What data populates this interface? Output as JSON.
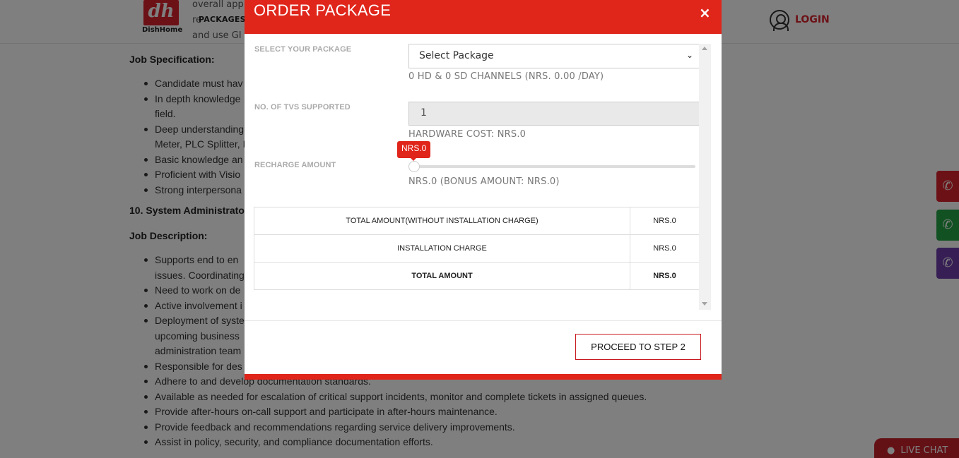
{
  "header": {
    "logo_text": "DishHome",
    "logo_mark": "dh",
    "nav_packages": "PACKAGES",
    "login_label": "LOGIN",
    "partial_lines": [
      "overall app",
      "re",
      "and use GI"
    ]
  },
  "background": {
    "job_spec_heading": "Job Specification:",
    "job_spec_items": [
      [
        "Candidate must hav"
      ],
      [
        "In depth knowledge",
        "field."
      ],
      [
        "Deep understanding",
        "Meter, PLC Splitter, I"
      ],
      [
        "Basic knowledge an"
      ],
      [
        "Proficient with Visio"
      ],
      [
        "Strong interpersona"
      ]
    ],
    "sysadmin_heading": "10. System Administrato",
    "job_desc_heading": "Job Description:",
    "job_desc_items": [
      [
        "Supports end to en",
        "issues. Coordinating"
      ],
      [
        "Need to work on de"
      ],
      [
        "Active involvement i"
      ],
      [
        "Deployment of syste",
        "upcoming  business",
        "administration team"
      ],
      [
        "Responsible for des"
      ],
      [
        "Adhere to and develop documentation standards."
      ],
      [
        "Available as needed for escalation of critical support incidents, monitor and complete tickets in assigned queues."
      ],
      [
        "Provide after-hours on-call support and participate in after-hours maintenance."
      ],
      [
        "Provide feedback and recommendations regarding service delivery improvements."
      ],
      [
        "Assist in policy, security, and compliance documentation efforts."
      ]
    ],
    "live_chat_label": "LIVE CHAT"
  },
  "modal": {
    "title": "ORDER PACKAGE",
    "close": "×",
    "package": {
      "label": "SELECT YOUR PACKAGE",
      "selected": "Select Package",
      "channels_text": "0 HD & 0 SD CHANNELS (NRS. 0.00 /DAY)"
    },
    "tvs": {
      "label": "NO. OF TVS SUPPORTED",
      "value": "1",
      "hardware_cost": "HARDWARE COST: NRS.0"
    },
    "recharge": {
      "label": "RECHARGE AMOUNT",
      "tooltip": "NRS.0",
      "level": 0,
      "summary": "NRS.0 (BONUS AMOUNT: NRS.0)"
    },
    "summary_rows": [
      {
        "label": "TOTAL AMOUNT(WITHOUT INSTALLATION CHARGE)",
        "amount": "NRS.0"
      },
      {
        "label": "INSTALLATION CHARGE",
        "amount": "NRS.0"
      },
      {
        "label": "TOTAL AMOUNT",
        "amount": "NRS.0"
      }
    ],
    "proceed_label": "PROCEED TO STEP 2"
  },
  "colors": {
    "brand_red": "#e0251b",
    "whatsapp_green": "#25a244",
    "viber_purple": "#6f3faa"
  },
  "icons": [
    "phone-icon",
    "whatsapp-icon",
    "viber-icon",
    "chat-icon",
    "user-icon",
    "close-icon",
    "chevron-down-icon"
  ]
}
